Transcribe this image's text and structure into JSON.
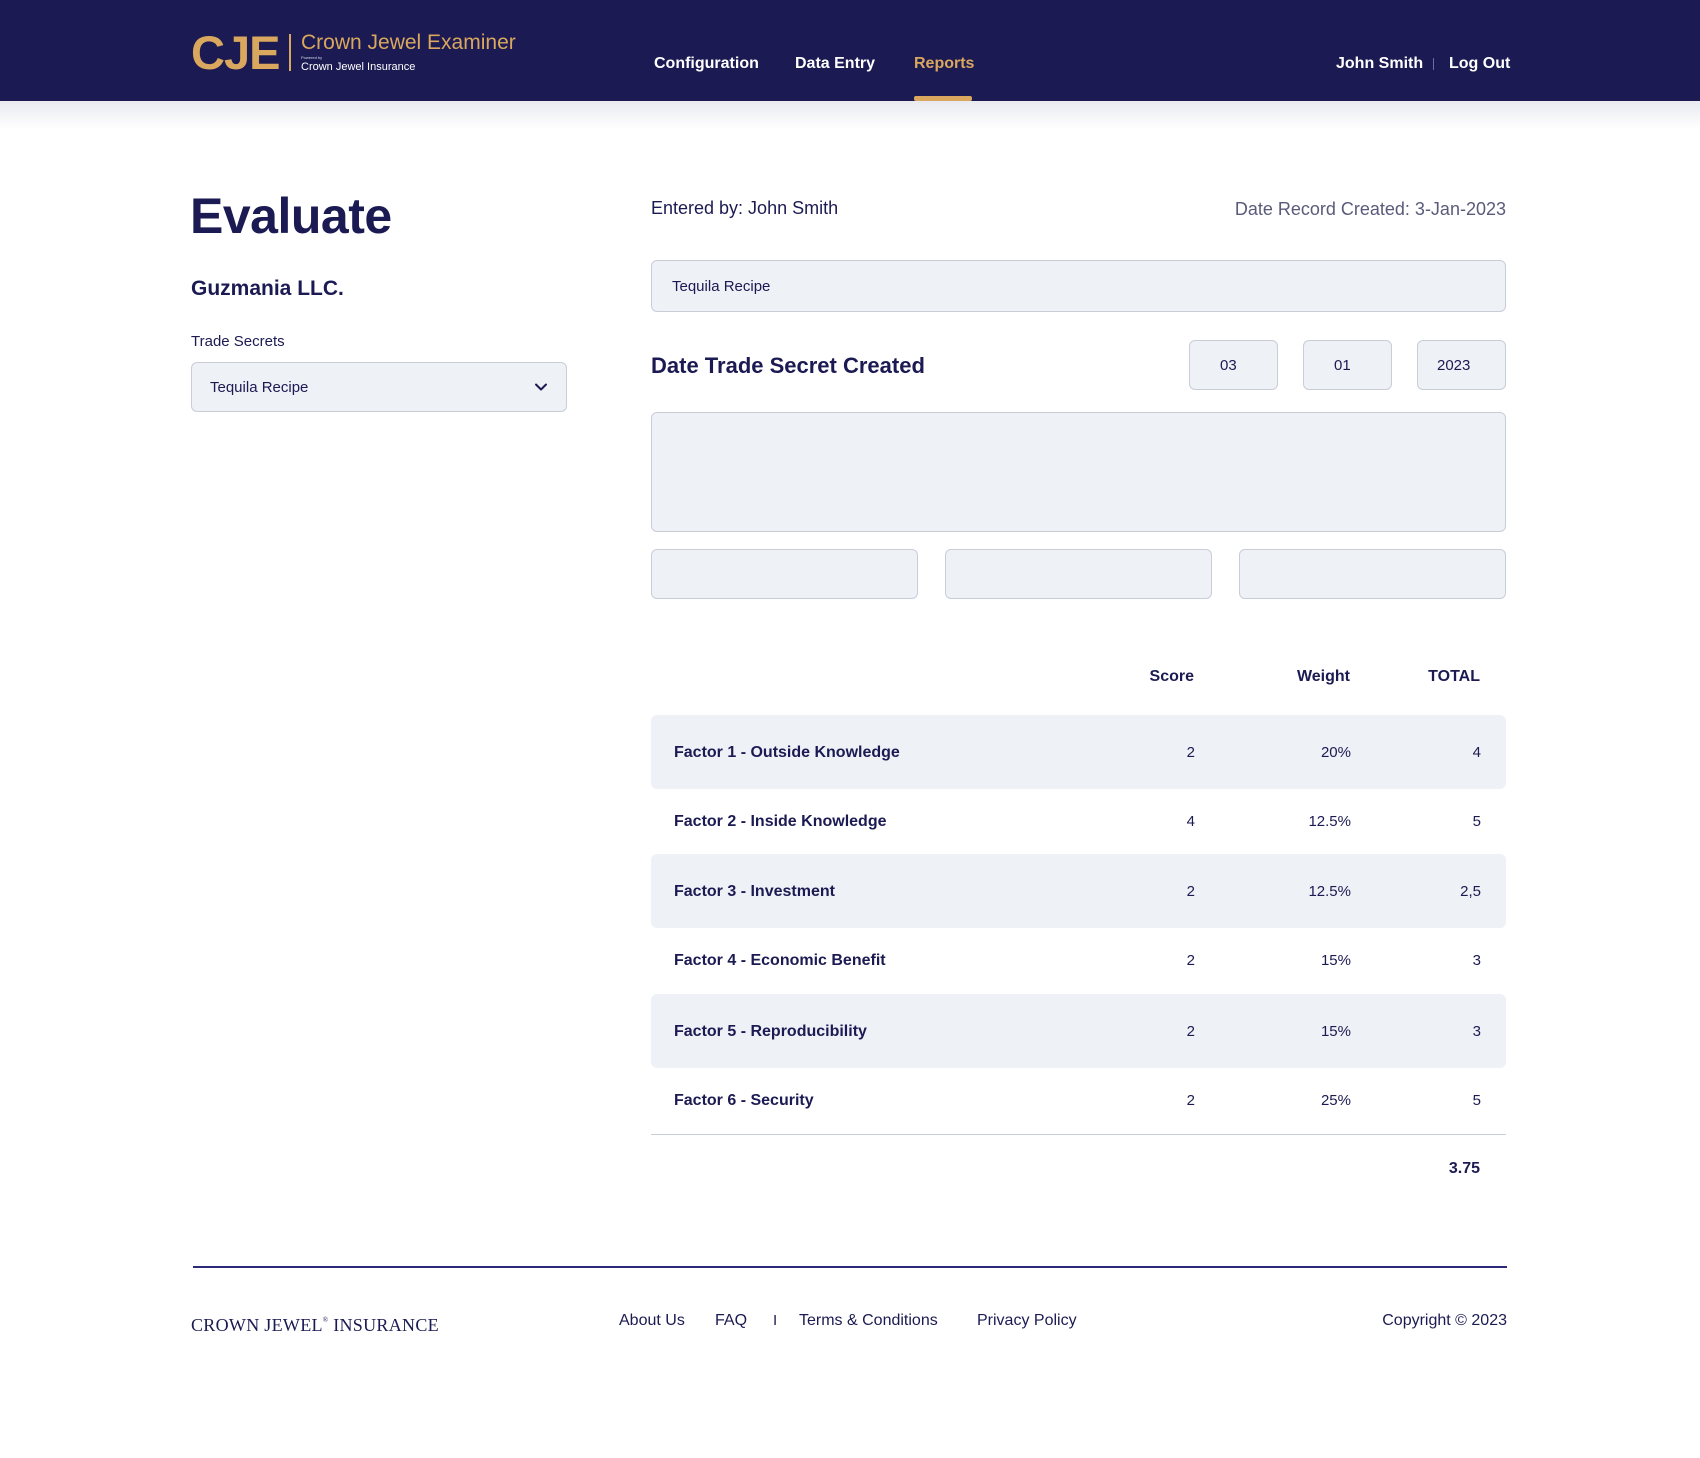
{
  "brand": {
    "mark": "CJE",
    "title": "Crown Jewel Examiner",
    "powered_by": "Powered by",
    "subtitle": "Crown Jewel Insurance",
    "accent_color": "#d9a75e",
    "header_color": "#1b1a52"
  },
  "nav": {
    "items": [
      {
        "label": "Configuration",
        "active": false
      },
      {
        "label": "Data Entry",
        "active": false
      },
      {
        "label": "Reports",
        "active": true
      }
    ]
  },
  "user": {
    "name": "John Smith",
    "logout_label": "Log Out"
  },
  "page": {
    "title": "Evaluate",
    "company": "Guzmania LLC.",
    "trade_secrets_label": "Trade Secrets",
    "trade_secret_selected": "Tequila Recipe"
  },
  "record": {
    "entered_by": "Entered by: John Smith",
    "date_created": "Date Record Created: 3-Jan-2023",
    "name_value": "Tequila Recipe",
    "date_label": "Date Trade Secret Created",
    "month": "03",
    "day": "01",
    "year": "2023",
    "description_value": "",
    "extra_fields": [
      "",
      "",
      ""
    ]
  },
  "scores": {
    "headers": {
      "score": "Score",
      "weight": "Weight",
      "total": "TOTAL"
    },
    "rows": [
      {
        "prefix": "Factor 1 - ",
        "name": "Outside Knowledge",
        "score": "2",
        "weight": "20%",
        "total": "4"
      },
      {
        "prefix": "Factor 2 - ",
        "name": "Inside Knowledge",
        "score": "4",
        "weight": "12.5%",
        "total": "5"
      },
      {
        "prefix": "Factor 3 - ",
        "name": "Investment",
        "score": "2",
        "weight": "12.5%",
        "total": "2,5"
      },
      {
        "prefix": "Factor 4 - ",
        "name": "Economic Benefit",
        "score": "2",
        "weight": "15%",
        "total": "3"
      },
      {
        "prefix": "Factor 5 - ",
        "name": "Reproducibility",
        "score": "2",
        "weight": "15%",
        "total": "3"
      },
      {
        "prefix": "Factor 6 - ",
        "name": "Security",
        "score": "2",
        "weight": "25%",
        "total": "5"
      }
    ],
    "grand_total": "3.75"
  },
  "footer": {
    "brand_left": "CROWN JEWEL",
    "brand_mark": "®",
    "brand_right": " INSURANCE",
    "links": [
      "About Us",
      "FAQ",
      "Terms & Conditions",
      "Privacy Policy"
    ],
    "separator": "I",
    "copyright": "Copyright © 2023"
  }
}
